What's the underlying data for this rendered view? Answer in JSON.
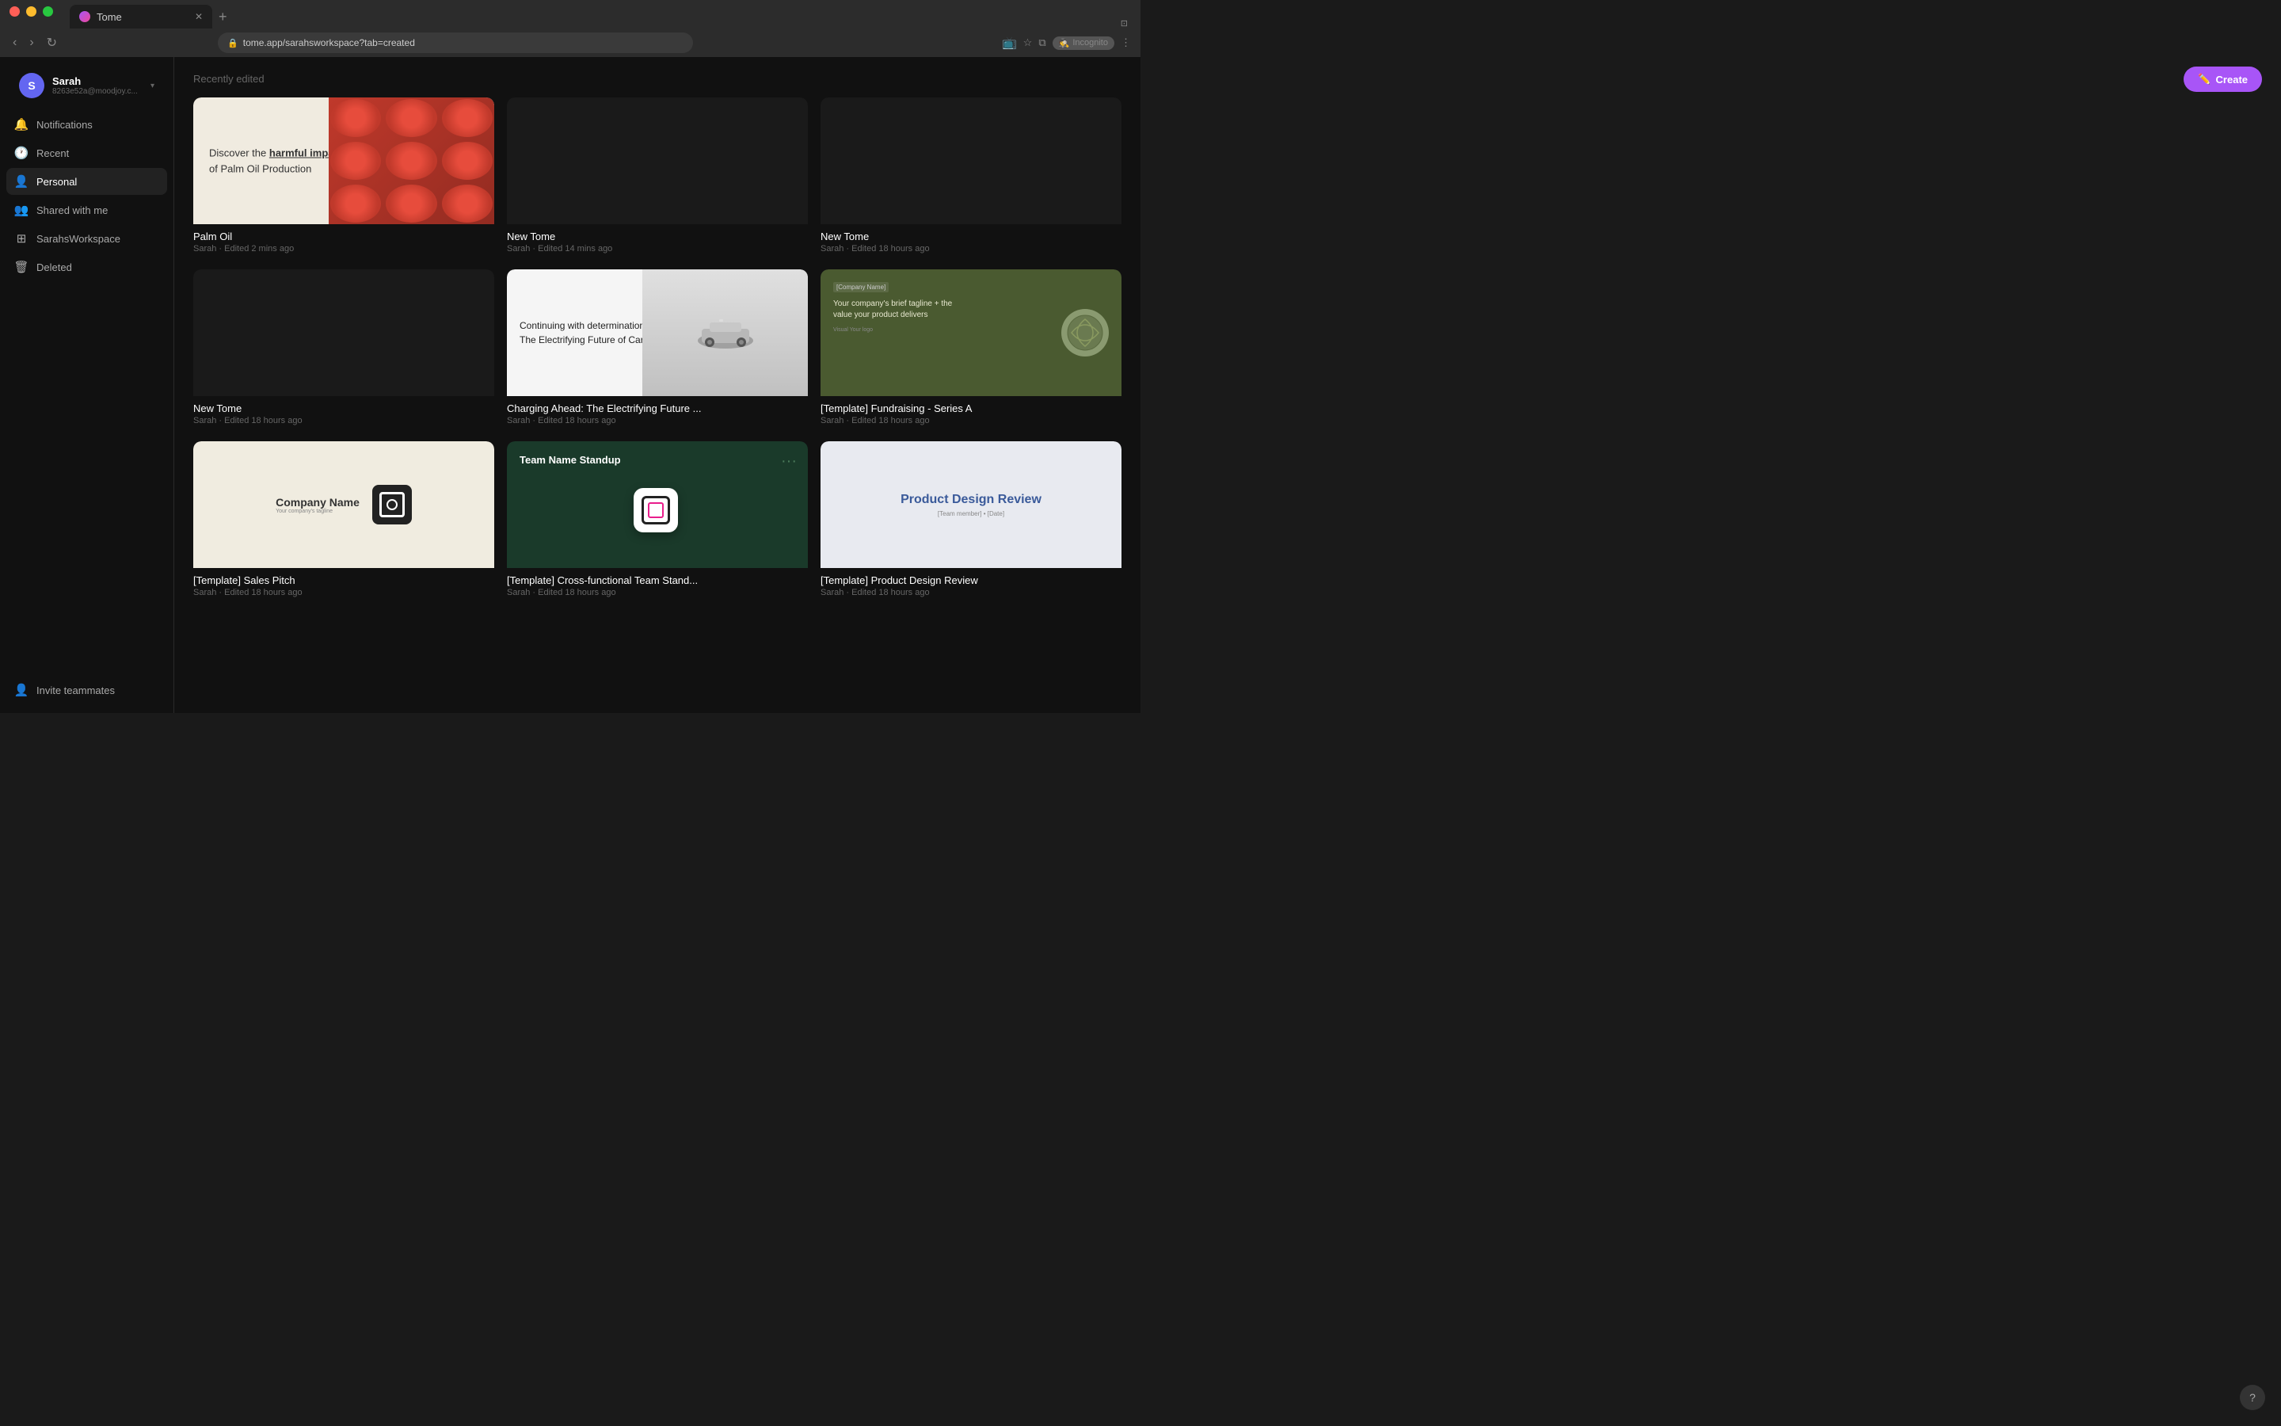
{
  "browser": {
    "tab_label": "Tome",
    "url": "tome.app/sarahsworkspace?tab=created",
    "new_tab_label": "+",
    "back_btn": "‹",
    "forward_btn": "›",
    "reload_btn": "↻",
    "incognito_label": "Incognito",
    "bookmark_icon": "☆",
    "extensions_icon": "⧉",
    "profile_icon": "👤",
    "menu_icon": "⋮"
  },
  "sidebar": {
    "user": {
      "name": "Sarah",
      "email": "8263e52a@moodjoy.c...",
      "avatar_letter": "S"
    },
    "items": [
      {
        "id": "notifications",
        "label": "Notifications",
        "icon": "🔔"
      },
      {
        "id": "recent",
        "label": "Recent",
        "icon": "🕐"
      },
      {
        "id": "personal",
        "label": "Personal",
        "icon": "👤"
      },
      {
        "id": "shared",
        "label": "Shared with me",
        "icon": "👥"
      },
      {
        "id": "workspace",
        "label": "SarahsWorkspace",
        "icon": "⊞"
      },
      {
        "id": "deleted",
        "label": "Deleted",
        "icon": "🗑"
      }
    ],
    "invite_label": "Invite teammates",
    "invite_icon": "👤+"
  },
  "main": {
    "section_header": "Recently edited",
    "create_button": "Create",
    "cards": [
      {
        "id": "palm-oil",
        "title": "Palm Oil",
        "meta": "Sarah · Edited 2 mins ago",
        "type": "palm-oil"
      },
      {
        "id": "new-tome-1",
        "title": "New Tome",
        "meta": "Sarah · Edited 14 mins ago",
        "type": "dark"
      },
      {
        "id": "new-tome-2",
        "title": "New Tome",
        "meta": "Sarah · Edited 18 hours ago",
        "type": "dark"
      },
      {
        "id": "new-tome-3",
        "title": "New Tome",
        "meta": "Sarah · Edited 18 hours ago",
        "type": "dark"
      },
      {
        "id": "charging",
        "title": "Charging Ahead: The Electrifying Future ...",
        "meta": "Sarah · Edited 18 hours ago",
        "type": "charging"
      },
      {
        "id": "fundraising",
        "title": "[Template] Fundraising - Series A",
        "meta": "Sarah · Edited 18 hours ago",
        "type": "fundraising"
      },
      {
        "id": "sales-pitch",
        "title": "[Template] Sales Pitch",
        "meta": "Sarah · Edited 18 hours ago",
        "type": "sales"
      },
      {
        "id": "standup",
        "title": "[Template] Cross-functional Team Stand...",
        "meta": "Sarah · Edited 18 hours ago",
        "type": "standup"
      },
      {
        "id": "product-design",
        "title": "[Template] Product Design Review",
        "meta": "Sarah · Edited 18 hours ago",
        "type": "product"
      }
    ],
    "palm_oil_text_part1": "Discover the ",
    "palm_oil_text_bold": "harmful impact",
    "palm_oil_text_part2": " of Palm Oil Production",
    "charging_text": "Continuing with determination.: The Electrifying Future of Cars",
    "fundraising_company": "[Company Name]",
    "fundraising_tagline": "Your company's brief tagline + the value your product delivers",
    "fundraising_visual": "Visual Your logo",
    "company_name": "Company Name",
    "company_tagline": "Your company's tagline",
    "standup_title": "Team Name Standup",
    "product_title": "Product Design Review",
    "product_subtitle": "[Team member] • [Date]"
  }
}
